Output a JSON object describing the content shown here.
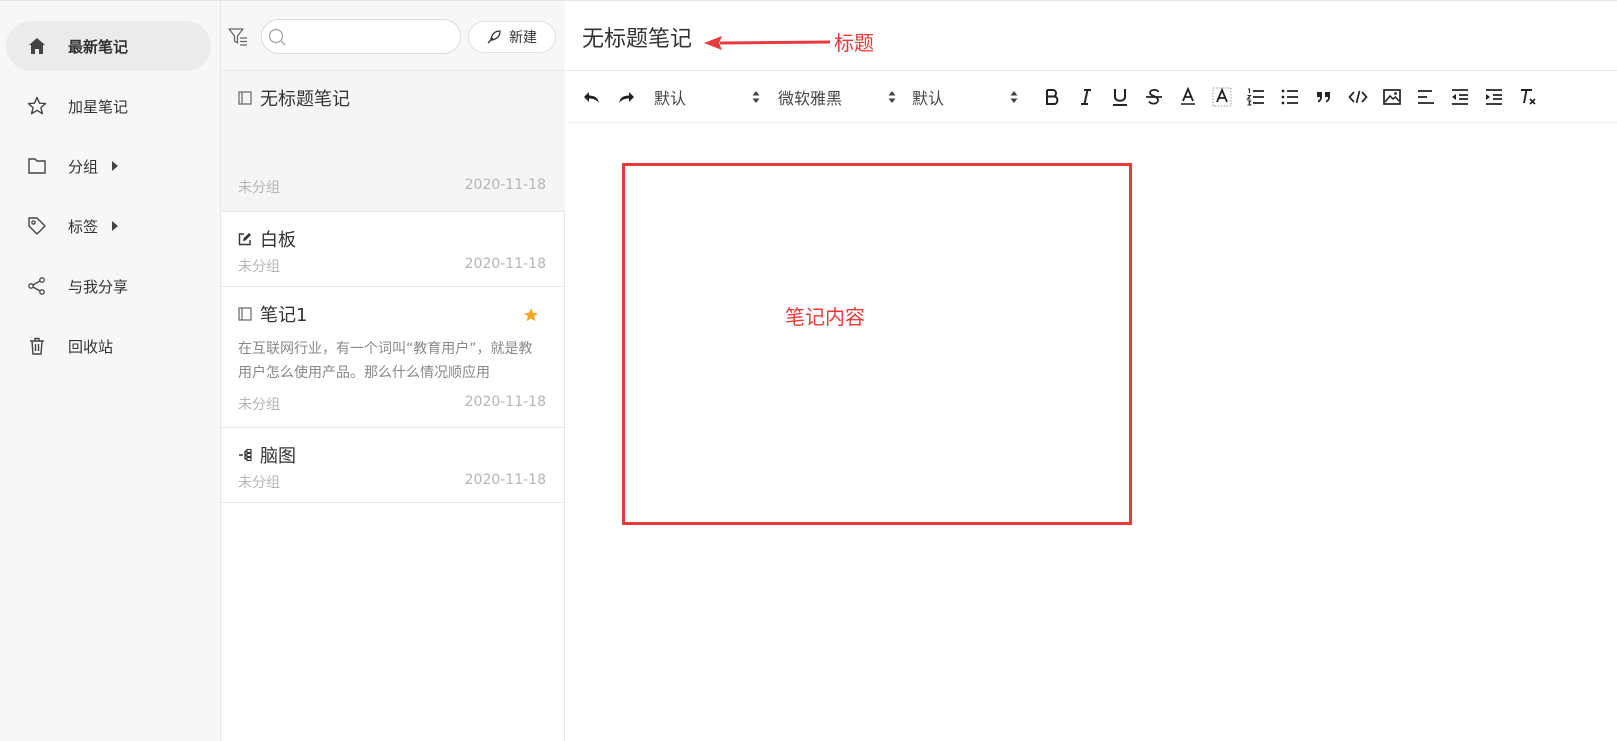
{
  "sidebar": {
    "items": [
      {
        "label": "最新笔记",
        "icon": "home-icon",
        "active": true
      },
      {
        "label": "加星笔记",
        "icon": "star-outline-icon"
      },
      {
        "label": "分组",
        "icon": "folder-icon",
        "expandable": true
      },
      {
        "label": "标签",
        "icon": "tag-icon",
        "expandable": true
      },
      {
        "label": "与我分享",
        "icon": "share-icon"
      },
      {
        "label": "回收站",
        "icon": "trash-icon"
      }
    ]
  },
  "notelist": {
    "search_placeholder": "",
    "new_label": "新建",
    "notes": [
      {
        "title": "无标题笔记",
        "type": "note",
        "excerpt": "",
        "group": "未分组",
        "date": "2020-11-18",
        "starred": false,
        "selected": true
      },
      {
        "title": "白板",
        "type": "whiteboard",
        "excerpt": "",
        "group": "未分组",
        "date": "2020-11-18",
        "starred": false
      },
      {
        "title": "笔记1",
        "type": "note",
        "excerpt": "在互联网行业，有一个词叫“教育用户”，就是教用户怎么使用产品。那么什么情况顺应用",
        "group": "未分组",
        "date": "2020-11-18",
        "starred": true
      },
      {
        "title": "脑图",
        "type": "mindmap",
        "excerpt": "",
        "group": "未分组",
        "date": "2020-11-18",
        "starred": false
      }
    ]
  },
  "editor": {
    "title": "无标题笔记",
    "toolbar": {
      "heading_select": "默认",
      "font_select": "微软雅黑",
      "size_select": "默认"
    },
    "annotations": {
      "title_label": "标题",
      "content_label": "笔记内容",
      "color": "#e83a3a"
    }
  },
  "colors": {
    "accent_star": "#f5a623",
    "annotation": "#e83a3a"
  }
}
